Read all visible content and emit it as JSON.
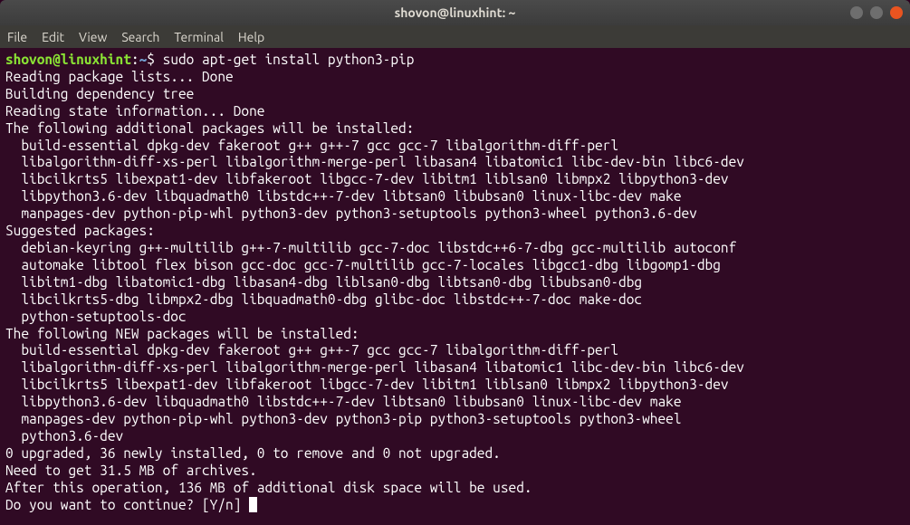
{
  "titlebar": {
    "title": "shovon@linuxhint: ~"
  },
  "menubar": {
    "file": "File",
    "edit": "Edit",
    "view": "View",
    "search": "Search",
    "terminal": "Terminal",
    "help": "Help"
  },
  "prompt": {
    "user_host": "shovon@linuxhint",
    "colon": ":",
    "path": "~",
    "dollar": "$"
  },
  "command": "sudo apt-get install python3-pip",
  "output_lines": [
    "Reading package lists... Done",
    "Building dependency tree",
    "Reading state information... Done",
    "The following additional packages will be installed:",
    "  build-essential dpkg-dev fakeroot g++ g++-7 gcc gcc-7 libalgorithm-diff-perl",
    "  libalgorithm-diff-xs-perl libalgorithm-merge-perl libasan4 libatomic1 libc-dev-bin libc6-dev",
    "  libcilkrts5 libexpat1-dev libfakeroot libgcc-7-dev libitm1 liblsan0 libmpx2 libpython3-dev",
    "  libpython3.6-dev libquadmath0 libstdc++-7-dev libtsan0 libubsan0 linux-libc-dev make",
    "  manpages-dev python-pip-whl python3-dev python3-setuptools python3-wheel python3.6-dev",
    "Suggested packages:",
    "  debian-keyring g++-multilib g++-7-multilib gcc-7-doc libstdc++6-7-dbg gcc-multilib autoconf",
    "  automake libtool flex bison gcc-doc gcc-7-multilib gcc-7-locales libgcc1-dbg libgomp1-dbg",
    "  libitm1-dbg libatomic1-dbg libasan4-dbg liblsan0-dbg libtsan0-dbg libubsan0-dbg",
    "  libcilkrts5-dbg libmpx2-dbg libquadmath0-dbg glibc-doc libstdc++-7-doc make-doc",
    "  python-setuptools-doc",
    "The following NEW packages will be installed:",
    "  build-essential dpkg-dev fakeroot g++ g++-7 gcc gcc-7 libalgorithm-diff-perl",
    "  libalgorithm-diff-xs-perl libalgorithm-merge-perl libasan4 libatomic1 libc-dev-bin libc6-dev",
    "  libcilkrts5 libexpat1-dev libfakeroot libgcc-7-dev libitm1 liblsan0 libmpx2 libpython3-dev",
    "  libpython3.6-dev libquadmath0 libstdc++-7-dev libtsan0 libubsan0 linux-libc-dev make",
    "  manpages-dev python-pip-whl python3-dev python3-pip python3-setuptools python3-wheel",
    "  python3.6-dev",
    "0 upgraded, 36 newly installed, 0 to remove and 0 not upgraded.",
    "Need to get 31.5 MB of archives.",
    "After this operation, 136 MB of additional disk space will be used.",
    "Do you want to continue? [Y/n] "
  ]
}
